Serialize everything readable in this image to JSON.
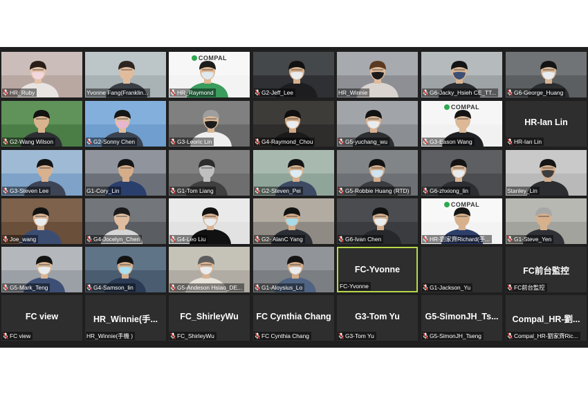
{
  "meeting": {
    "tiles": [
      {
        "name": "HR_Ruby",
        "muted": true,
        "video": true,
        "bg": "#b9a7a2",
        "shirt": "#e8e4e2",
        "skin": "#e6c2a8",
        "mask": "#f3d7df",
        "hair": "#2a1d18",
        "wall": "#d7cdc9"
      },
      {
        "name": "Yvonne Fang(Franklin...",
        "muted": false,
        "video": true,
        "bg": "#a9b3b6",
        "shirt": "#3a3f45",
        "skin": "#e1bc9c",
        "mask": "none",
        "hair": "#2d2420",
        "wall": "#c9d1d3"
      },
      {
        "name": "HR_Raymond",
        "muted": true,
        "video": true,
        "bg": "#f3f3f3",
        "shirt": "#3a9c5d",
        "skin": "#e0b894",
        "mask": "#dfe9ef",
        "hair": "#1d1d1d",
        "wall": "#fafafa",
        "logo": "COMPAL"
      },
      {
        "name": "G2-Jeff_Lee",
        "muted": true,
        "video": true,
        "bg": "#2f3033",
        "shirt": "#1d1d20",
        "skin": "#d6b08c",
        "mask": "#e9ecef",
        "hair": "#111111",
        "wall": "#55585c"
      },
      {
        "name": "HR_Winnie",
        "muted": false,
        "video": true,
        "bg": "#8d8f94",
        "shirt": "#d9d4cf",
        "skin": "#e0bb9b",
        "mask": "#1b1b1b",
        "hair": "#5a3b21",
        "wall": "#b9bcc1"
      },
      {
        "name": "G6-Jacky_Hsieh CE_TT...",
        "muted": true,
        "video": true,
        "bg": "#9ea3a6",
        "shirt": "#2a2c30",
        "skin": "#d9b594",
        "mask": "#3d4f73",
        "hair": "#141414",
        "wall": "#c5cacd"
      },
      {
        "name": "G6-George_Huang",
        "muted": true,
        "video": true,
        "bg": "#5c5f62",
        "shirt": "#2b2c2e",
        "skin": "#d8b594",
        "mask": "#e9ecef",
        "hair": "#141414",
        "wall": "#7e8285"
      },
      {
        "name": "G2-Wang Wilson",
        "muted": true,
        "video": true,
        "bg": "#4b7d47",
        "shirt": "#2d2f33",
        "skin": "#d9b38e",
        "mask": "none",
        "hair": "#121212",
        "wall": "#6ea166"
      },
      {
        "name": "G2-Sonny Chen",
        "muted": true,
        "video": true,
        "bg": "#6f9ecf",
        "shirt": "#3b4350",
        "skin": "#e0bd9f",
        "mask": "#e7b7d0",
        "hair": "#161616",
        "wall": "#8fbbe3"
      },
      {
        "name": "G3-Leoric Lin",
        "muted": true,
        "video": true,
        "bg": "#6b6b6b",
        "shirt": "#efefef",
        "skin": "#d9b898",
        "mask": "#1c1c1c",
        "hair": "#9e9e9e",
        "wall": "#8e8e8e"
      },
      {
        "name": "G4-Raymond_Chou",
        "muted": true,
        "video": true,
        "bg": "#2f2d2b",
        "shirt": "#1a1a1a",
        "skin": "#d2a982",
        "mask": "#e9ecef",
        "hair": "#0f0f0f",
        "wall": "#4a4642"
      },
      {
        "name": "G5-yuchang_wu",
        "muted": true,
        "video": true,
        "bg": "#8b8e92",
        "shirt": "#2d2e30",
        "skin": "#d8b393",
        "mask": "#e9ecef",
        "hair": "#121212",
        "wall": "#b0b3b7"
      },
      {
        "name": "G3-Eason Wang",
        "muted": true,
        "video": true,
        "bg": "#f1f1f1",
        "shirt": "#1f2023",
        "skin": "#dcb896",
        "mask": "none",
        "hair": "#141414",
        "wall": "#fafafa",
        "logo": "COMPAL"
      },
      {
        "name": "HR-Ian Lin",
        "muted": true,
        "video": false,
        "big": "HR-Ian Lin"
      },
      {
        "name": "G3-Steven Lee",
        "muted": true,
        "video": true,
        "bg": "#7ea2c8",
        "shirt": "#3d4455",
        "skin": "#d9b18f",
        "mask": "none",
        "hair": "#151515",
        "wall": "#b5c9de"
      },
      {
        "name": "G1-Cory_Lin",
        "muted": false,
        "video": true,
        "bg": "#6c7179",
        "shirt": "#2b3f6d",
        "skin": "#d6ad89",
        "mask": "none",
        "hair": "#141414",
        "wall": "#a6acb5"
      },
      {
        "name": "G1-Tom Liang",
        "muted": true,
        "video": true,
        "bg": "#6e6e6e",
        "shirt": "#3f3f3f",
        "skin": "#bfbfbf",
        "mask": "none",
        "hair": "#2c2c2c",
        "wall": "#8c8c8c"
      },
      {
        "name": "G2-Steven_Pei",
        "muted": true,
        "video": true,
        "bg": "#8fa59a",
        "shirt": "#3e4a63",
        "skin": "#d7b08d",
        "mask": "#dcecf5",
        "hair": "#141414",
        "wall": "#b9c8bf"
      },
      {
        "name": "G5-Robbie Huang (RTD)",
        "muted": true,
        "video": true,
        "bg": "#6d7074",
        "shirt": "#3a3c40",
        "skin": "#d3ad8c",
        "mask": "#cfe3f1",
        "hair": "#121212",
        "wall": "#8f9296"
      },
      {
        "name": "G6-zhxiong_lin",
        "muted": true,
        "video": true,
        "bg": "#4b4d50",
        "shirt": "#2b2d31",
        "skin": "#d9b594",
        "mask": "#e9ecef",
        "hair": "#131313",
        "wall": "#6a6c70"
      },
      {
        "name": "Stanley_Lin",
        "muted": false,
        "video": true,
        "bg": "#b9b9b9",
        "shirt": "#2c2d30",
        "skin": "#d3ad8c",
        "mask": "#3d3d3d",
        "hair": "#151515",
        "wall": "#d4d4d4"
      },
      {
        "name": "Joe_wang",
        "muted": true,
        "video": true,
        "bg": "#6a4f3b",
        "shirt": "#3c4d72",
        "skin": "#dab594",
        "mask": "#e9ecef",
        "hair": "#121212",
        "wall": "#8c6f58"
      },
      {
        "name": "G4-Jocelyn_Chen",
        "muted": true,
        "video": true,
        "bg": "#5a5d61",
        "shirt": "#d6d6d6",
        "skin": "#e0bd9f",
        "mask": "none",
        "hair": "#1b1b1b",
        "wall": "#84878b"
      },
      {
        "name": "G4-Leo Liu",
        "muted": true,
        "video": true,
        "bg": "#e2e2e2",
        "shirt": "#111111",
        "skin": "#d8b393",
        "mask": "#e9ecef",
        "hair": "#111111",
        "wall": "#f0f0f0"
      },
      {
        "name": "G2- AlanC Yang",
        "muted": true,
        "video": true,
        "bg": "#8f8a83",
        "shirt": "#2b2e35",
        "skin": "#d4ad8b",
        "mask": "#a8dbe9",
        "hair": "#131313",
        "wall": "#c9c2b8"
      },
      {
        "name": "G6-Ivan Chen",
        "muted": true,
        "video": true,
        "bg": "#3b3c3f",
        "shirt": "#27282b",
        "skin": "#d3ad8c",
        "mask": "#e9ecef",
        "hair": "#111111",
        "wall": "#55575b"
      },
      {
        "name": "HR-劉家齊Richard(手...",
        "muted": true,
        "video": true,
        "bg": "#f3f3f3",
        "shirt": "#2e3f6b",
        "skin": "#d8b08c",
        "mask": "none",
        "hair": "#151515",
        "wall": "#fbfbfb",
        "logo": "COMPAL"
      },
      {
        "name": "G1-Steve_Yen",
        "muted": true,
        "video": true,
        "bg": "#a3a39d",
        "shirt": "#2f3136",
        "skin": "#d7b08c",
        "mask": "none",
        "hair": "#a7a7a7",
        "wall": "#c7c6c0"
      },
      {
        "name": "G5-Mark_Teng",
        "muted": true,
        "video": true,
        "bg": "#9ba0a6",
        "shirt": "#3d4f74",
        "skin": "#d9b594",
        "mask": "#e9ecef",
        "hair": "#131313",
        "wall": "#c4c8cd"
      },
      {
        "name": "G4-Samson_lin",
        "muted": true,
        "video": true,
        "bg": "#4a5c6f",
        "shirt": "#2b3b55",
        "skin": "#d6af8d",
        "mask": "#a9dff0",
        "hair": "#121212",
        "wall": "#6f839a"
      },
      {
        "name": "G5-Andeson Hsiao_DE...",
        "muted": true,
        "video": true,
        "bg": "#b0aca4",
        "shirt": "#e7e2da",
        "skin": "#d9b393",
        "mask": "#e9ecef",
        "hair": "#5d5d5d",
        "wall": "#d4d0c7"
      },
      {
        "name": "G1-Aloysius_Lo",
        "muted": true,
        "video": true,
        "bg": "#7b7e82",
        "shirt": "#4f6382",
        "skin": "#d2ac8a",
        "mask": "#e9ecef",
        "hair": "#141414",
        "wall": "#a0a3a7"
      },
      {
        "name": "FC-Yvonne",
        "muted": false,
        "video": false,
        "big": "FC-Yvonne",
        "active": true
      },
      {
        "name": "G1-Jackson_Yu",
        "muted": true,
        "video": false,
        "big": ""
      },
      {
        "name": "FC前台監控",
        "muted": true,
        "video": false,
        "big": "FC前台監控"
      },
      {
        "name": "FC view",
        "muted": true,
        "video": false,
        "big": "FC view"
      },
      {
        "name": "HR_Winnie(手機 )",
        "muted": false,
        "video": false,
        "big": "HR_Winnie(手..."
      },
      {
        "name": "FC_ShirleyWu",
        "muted": true,
        "video": false,
        "big": "FC_ShirleyWu"
      },
      {
        "name": "FC Cynthia Chang",
        "muted": true,
        "video": false,
        "big": "FC Cynthia Chang"
      },
      {
        "name": "G3-Tom Yu",
        "muted": true,
        "video": false,
        "big": "G3-Tom Yu"
      },
      {
        "name": "G5-SimonJH_Tseng",
        "muted": true,
        "video": false,
        "big": "G5-SimonJH_Ts..."
      },
      {
        "name": "Compal_HR-劉家齊Ric...",
        "muted": true,
        "video": false,
        "big": "Compal_HR-劉..."
      }
    ]
  }
}
